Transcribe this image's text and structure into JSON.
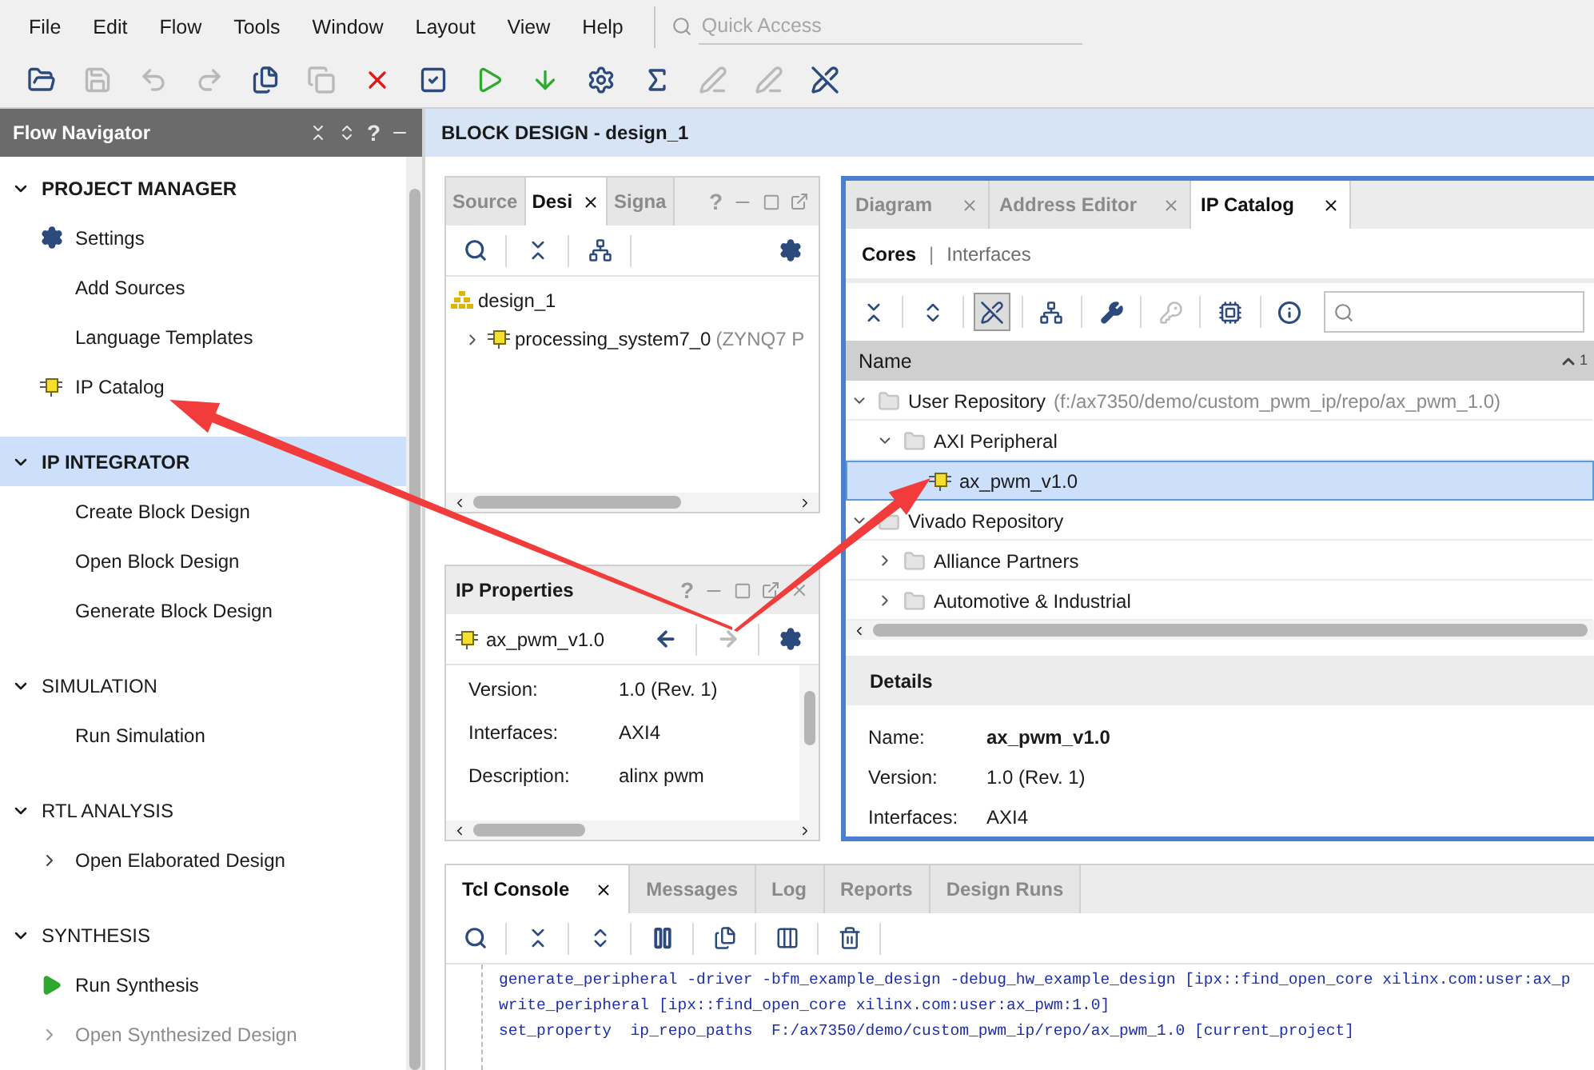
{
  "menu": [
    "File",
    "Edit",
    "Flow",
    "Tools",
    "Window",
    "Layout",
    "View",
    "Help"
  ],
  "quick_access": {
    "placeholder": "Quick Access"
  },
  "toolbar": [
    {
      "disabled": false
    },
    {
      "disabled": true
    },
    {
      "disabled": true
    },
    {
      "disabled": true
    },
    {
      "disabled": false
    },
    {
      "disabled": true
    },
    {
      "disabled": false
    },
    {
      "disabled": false
    },
    {
      "disabled": false
    },
    {
      "disabled": false
    },
    {
      "disabled": false
    },
    {
      "disabled": false
    },
    {
      "disabled": true
    },
    {
      "disabled": true
    },
    {
      "disabled": false
    }
  ],
  "flow_navigator": {
    "title": "Flow Navigator",
    "help": "?",
    "sections": [
      {
        "title": "PROJECT MANAGER",
        "bold": true,
        "expanded": true,
        "selected": false,
        "items": [
          {
            "label": "Settings",
            "kind": "gear",
            "disabled": false
          },
          {
            "label": "Add Sources",
            "kind": "plain",
            "disabled": false
          },
          {
            "label": "Language Templates",
            "kind": "plain",
            "disabled": false
          },
          {
            "label": "IP Catalog",
            "kind": "ip",
            "disabled": false
          }
        ]
      },
      {
        "title": "IP INTEGRATOR",
        "bold": true,
        "expanded": true,
        "selected": true,
        "items": [
          {
            "label": "Create Block Design",
            "kind": "plain",
            "disabled": false
          },
          {
            "label": "Open Block Design",
            "kind": "plain",
            "disabled": false
          },
          {
            "label": "Generate Block Design",
            "kind": "plain",
            "disabled": false
          }
        ]
      },
      {
        "title": "SIMULATION",
        "bold": false,
        "expanded": true,
        "selected": false,
        "items": [
          {
            "label": "Run Simulation",
            "kind": "plain",
            "disabled": false
          }
        ]
      },
      {
        "title": "RTL ANALYSIS",
        "bold": false,
        "expanded": true,
        "selected": false,
        "items": [
          {
            "label": "Open Elaborated Design",
            "kind": "expandable",
            "disabled": false
          }
        ]
      },
      {
        "title": "SYNTHESIS",
        "bold": false,
        "expanded": true,
        "selected": false,
        "items": [
          {
            "label": "Run Synthesis",
            "kind": "run",
            "disabled": false
          },
          {
            "label": "Open Synthesized Design",
            "kind": "expandable",
            "disabled": true
          }
        ]
      }
    ]
  },
  "block_design": {
    "title": "BLOCK DESIGN - design_1"
  },
  "sources_panel": {
    "tabs": [
      {
        "label": "Source",
        "selected": false
      },
      {
        "label": "Desi",
        "selected": true
      },
      {
        "label": "Signa",
        "selected": false
      }
    ],
    "help": "?",
    "tree": [
      {
        "label": "design_1",
        "kind": "design",
        "children": [
          {
            "label": "processing_system7_0",
            "note": "(ZYNQ7 P",
            "kind": "ip",
            "expanded": false
          }
        ]
      }
    ]
  },
  "ip_properties": {
    "title": "IP Properties",
    "help": "?",
    "name": "ax_pwm_v1.0",
    "back_disabled": false,
    "forward_disabled": true,
    "fields": [
      {
        "label": "Version:",
        "value": "1.0 (Rev. 1)"
      },
      {
        "label": "Interfaces:",
        "value": "AXI4"
      },
      {
        "label": "Description:",
        "value": "alinx pwm"
      }
    ]
  },
  "ip_catalog": {
    "tabs": [
      {
        "label": "Diagram",
        "selected": false
      },
      {
        "label": "Address Editor",
        "selected": false
      },
      {
        "label": "IP Catalog",
        "selected": true
      }
    ],
    "views": [
      {
        "label": "Cores",
        "selected": true
      },
      {
        "label": "Interfaces",
        "selected": false
      }
    ],
    "separator": "|",
    "column": "Name",
    "sort_index": "1",
    "tree": [
      {
        "label": "User Repository",
        "note": "(f:/ax7350/demo/custom_pwm_ip/repo/ax_pwm_1.0)",
        "kind": "folder",
        "expanded": true,
        "selected": false,
        "children": [
          {
            "label": "AXI Peripheral",
            "kind": "folder",
            "expanded": true,
            "selected": false,
            "children": [
              {
                "label": "ax_pwm_v1.0",
                "kind": "ip",
                "selected": true
              }
            ]
          }
        ]
      },
      {
        "label": "Vivado Repository",
        "kind": "folder",
        "expanded": true,
        "selected": false,
        "children": [
          {
            "label": "Alliance Partners",
            "kind": "folder",
            "expanded": false,
            "selected": false
          },
          {
            "label": "Automotive & Industrial",
            "kind": "folder",
            "expanded": false,
            "selected": false
          }
        ]
      }
    ],
    "details": {
      "title": "Details",
      "fields": [
        {
          "label": "Name:",
          "value": "ax_pwm_v1.0",
          "bold": true
        },
        {
          "label": "Version:",
          "value": "1.0 (Rev. 1)",
          "bold": false
        },
        {
          "label": "Interfaces:",
          "value": "AXI4",
          "bold": false
        }
      ]
    }
  },
  "tcl_console": {
    "tabs": [
      {
        "label": "Tcl Console",
        "selected": true
      },
      {
        "label": "Messages",
        "selected": false
      },
      {
        "label": "Log",
        "selected": false
      },
      {
        "label": "Reports",
        "selected": false
      },
      {
        "label": "Design Runs",
        "selected": false
      }
    ],
    "lines": [
      "generate_peripheral -driver -bfm_example_design -debug_hw_example_design [ipx::find_open_core xilinx.com:user:ax_p",
      "write_peripheral [ipx::find_open_core xilinx.com:user:ax_pwm:1.0]",
      "set_property  ip_repo_paths  F:/ax7350/demo/custom_pwm_ip/repo/ax_pwm_1.0 [current_project]"
    ]
  }
}
